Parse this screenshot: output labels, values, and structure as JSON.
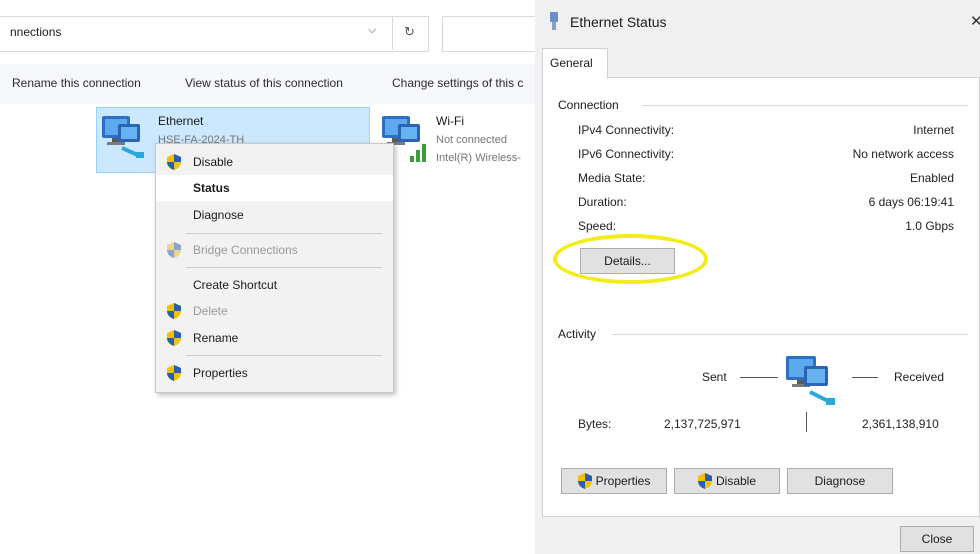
{
  "explorer": {
    "address_text": "nnections",
    "commands": {
      "rename": "Rename this connection",
      "view_status": "View status of this connection",
      "change_settings": "Change settings of this c"
    },
    "adapters": [
      {
        "name": "Ethernet",
        "sub": "HSE-FA-2024-TH"
      },
      {
        "name": "Wi-Fi",
        "status": "Not connected",
        "device": "Intel(R) Wireless-"
      }
    ]
  },
  "context_menu": {
    "items": [
      {
        "label": "Disable",
        "shield": true,
        "enabled": true
      },
      {
        "label": "Status",
        "bold": true,
        "enabled": true
      },
      {
        "label": "Diagnose",
        "enabled": true
      },
      {
        "label": "Bridge Connections",
        "shield": true,
        "enabled": false
      },
      {
        "label": "Create Shortcut",
        "enabled": true
      },
      {
        "label": "Delete",
        "shield": true,
        "enabled": false
      },
      {
        "label": "Rename",
        "shield": true,
        "enabled": true
      },
      {
        "label": "Properties",
        "shield": true,
        "enabled": true
      }
    ]
  },
  "dialog": {
    "title": "Ethernet Status",
    "close_x": "✕",
    "tab": "General",
    "connection": {
      "label": "Connection",
      "ipv4_label": "IPv4 Connectivity:",
      "ipv4_value": "Internet",
      "ipv6_label": "IPv6 Connectivity:",
      "ipv6_value": "No network access",
      "media_label": "Media State:",
      "media_value": "Enabled",
      "duration_label": "Duration:",
      "duration_value": "6 days 06:19:41",
      "speed_label": "Speed:",
      "speed_value": "1.0 Gbps",
      "details_button": "Details..."
    },
    "activity": {
      "label": "Activity",
      "sent": "Sent",
      "received": "Received",
      "bytes_label": "Bytes:",
      "bytes_sent": "2,137,725,971",
      "bytes_received": "2,361,138,910"
    },
    "buttons": {
      "properties": "Properties",
      "disable": "Disable",
      "diagnose": "Diagnose",
      "close": "Close"
    }
  },
  "colors": {
    "selection": "#cce8ff",
    "highlight_ring": "#f2ec1a",
    "dialog_bg": "#f0f0f0"
  }
}
